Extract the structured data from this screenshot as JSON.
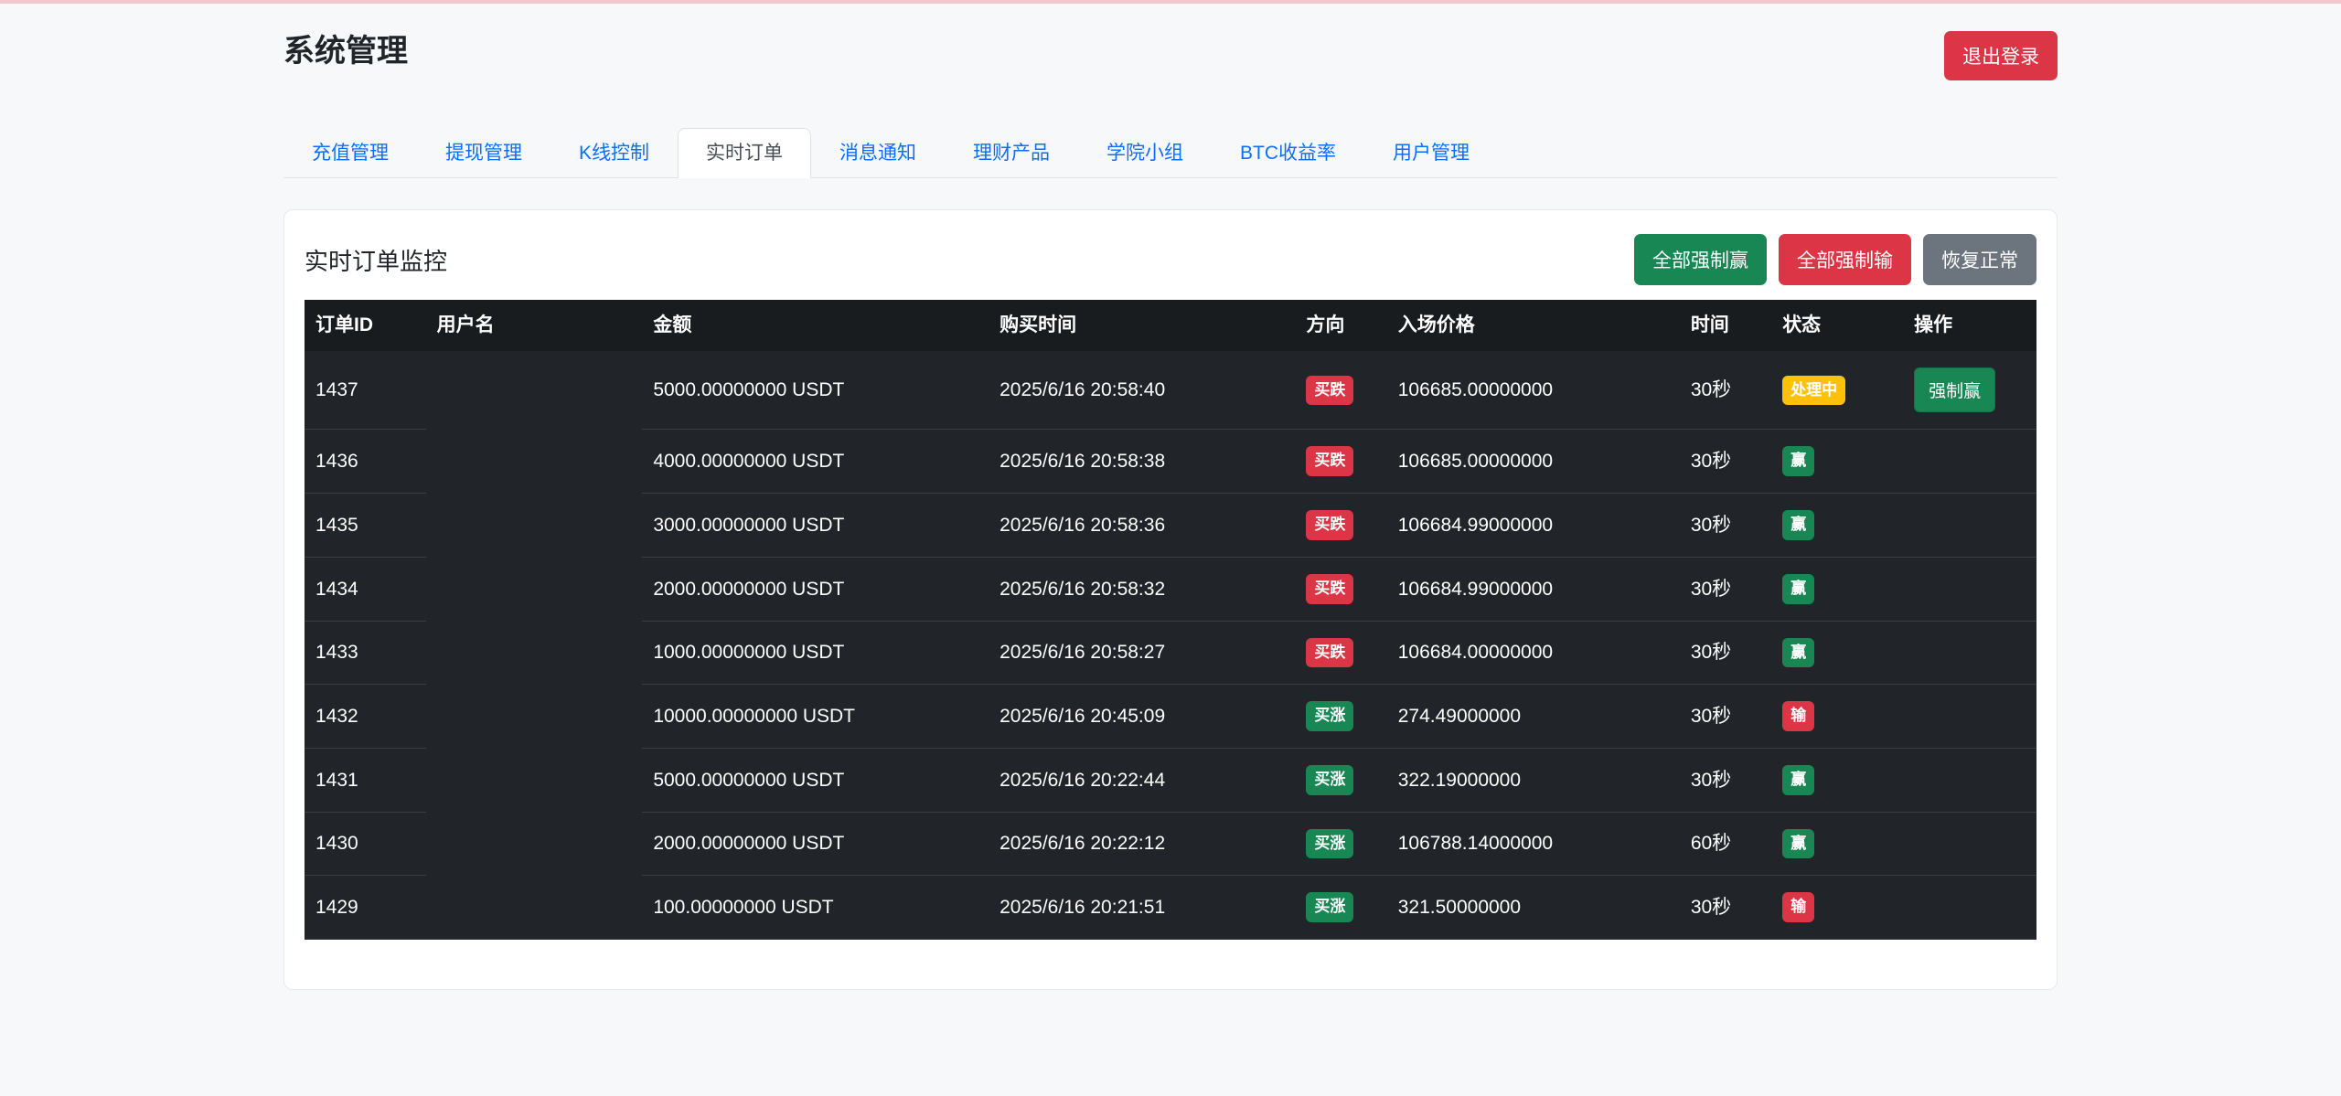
{
  "page": {
    "title": "系统管理",
    "logout_label": "退出登录"
  },
  "tabs": [
    {
      "name": "recharge",
      "label": "充值管理",
      "active": false
    },
    {
      "name": "withdraw",
      "label": "提现管理",
      "active": false
    },
    {
      "name": "kline-control",
      "label": "K线控制",
      "active": false
    },
    {
      "name": "realtime-orders",
      "label": "实时订单",
      "active": true
    },
    {
      "name": "notifications",
      "label": "消息通知",
      "active": false
    },
    {
      "name": "financial-products",
      "label": "理财产品",
      "active": false
    },
    {
      "name": "academy-group",
      "label": "学院小组",
      "active": false
    },
    {
      "name": "btc-yield",
      "label": "BTC收益率",
      "active": false
    },
    {
      "name": "user-management",
      "label": "用户管理",
      "active": false
    }
  ],
  "panel": {
    "title": "实时订单监控",
    "buttons": {
      "force_win_all": "全部强制赢",
      "force_lose_all": "全部强制输",
      "restore_normal": "恢复正常"
    }
  },
  "table": {
    "headers": [
      "订单ID",
      "用户名",
      "金额",
      "购买时间",
      "方向",
      "入场价格",
      "时间",
      "状态",
      "操作"
    ],
    "rows": [
      {
        "id": "1437",
        "username": "",
        "amount": "5000.00000000 USDT",
        "time": "2025/6/16 20:58:40",
        "direction": "买跌",
        "direction_type": "down",
        "price": "106685.00000000",
        "duration": "30秒",
        "status": "处理中",
        "status_type": "processing",
        "action": "强制赢"
      },
      {
        "id": "1436",
        "username": "",
        "amount": "4000.00000000 USDT",
        "time": "2025/6/16 20:58:38",
        "direction": "买跌",
        "direction_type": "down",
        "price": "106685.00000000",
        "duration": "30秒",
        "status": "赢",
        "status_type": "win",
        "action": null
      },
      {
        "id": "1435",
        "username": "",
        "amount": "3000.00000000 USDT",
        "time": "2025/6/16 20:58:36",
        "direction": "买跌",
        "direction_type": "down",
        "price": "106684.99000000",
        "duration": "30秒",
        "status": "赢",
        "status_type": "win",
        "action": null
      },
      {
        "id": "1434",
        "username": "",
        "amount": "2000.00000000 USDT",
        "time": "2025/6/16 20:58:32",
        "direction": "买跌",
        "direction_type": "down",
        "price": "106684.99000000",
        "duration": "30秒",
        "status": "赢",
        "status_type": "win",
        "action": null
      },
      {
        "id": "1433",
        "username": "",
        "amount": "1000.00000000 USDT",
        "time": "2025/6/16 20:58:27",
        "direction": "买跌",
        "direction_type": "down",
        "price": "106684.00000000",
        "duration": "30秒",
        "status": "赢",
        "status_type": "win",
        "action": null
      },
      {
        "id": "1432",
        "username": "",
        "amount": "10000.00000000 USDT",
        "time": "2025/6/16 20:45:09",
        "direction": "买涨",
        "direction_type": "up",
        "price": "274.49000000",
        "duration": "30秒",
        "status": "输",
        "status_type": "lose",
        "action": null
      },
      {
        "id": "1431",
        "username": "",
        "amount": "5000.00000000 USDT",
        "time": "2025/6/16 20:22:44",
        "direction": "买涨",
        "direction_type": "up",
        "price": "322.19000000",
        "duration": "30秒",
        "status": "赢",
        "status_type": "win",
        "action": null
      },
      {
        "id": "1430",
        "username": "",
        "amount": "2000.00000000 USDT",
        "time": "2025/6/16 20:22:12",
        "direction": "买涨",
        "direction_type": "up",
        "price": "106788.14000000",
        "duration": "60秒",
        "status": "赢",
        "status_type": "win",
        "action": null
      },
      {
        "id": "1429",
        "username": "",
        "amount": "100.00000000 USDT",
        "time": "2025/6/16 20:21:51",
        "direction": "买涨",
        "direction_type": "up",
        "price": "321.50000000",
        "duration": "30秒",
        "status": "输",
        "status_type": "lose",
        "action": null
      }
    ]
  },
  "colors": {
    "accent_blue": "#0d6efd",
    "success_green": "#198754",
    "danger_red": "#dc3545",
    "warning_yellow": "#ffc107",
    "secondary_gray": "#6c757d",
    "table_header_bg": "#191c1f",
    "table_row_bg": "#212529",
    "top_accent_pink": "#f3c6cc",
    "page_bg": "#f7f8fa"
  }
}
